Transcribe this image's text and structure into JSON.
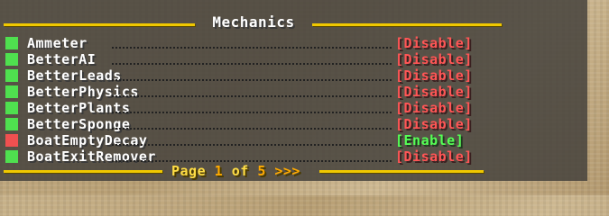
{
  "panel": {
    "title": "Mechanics"
  },
  "features": [
    {
      "name": "Ammeter",
      "enabled": true,
      "action": "[Disable]"
    },
    {
      "name": "BetterAI",
      "enabled": true,
      "action": "[Disable]"
    },
    {
      "name": "BetterLeads",
      "enabled": true,
      "action": "[Disable]"
    },
    {
      "name": "BetterPhysics",
      "enabled": true,
      "action": "[Disable]"
    },
    {
      "name": "BetterPlants",
      "enabled": true,
      "action": "[Disable]"
    },
    {
      "name": "BetterSponge",
      "enabled": true,
      "action": "[Disable]"
    },
    {
      "name": "BoatEmptyDecay",
      "enabled": false,
      "action": "[Enable]"
    },
    {
      "name": "BoatExitRemover",
      "enabled": true,
      "action": "[Disable]"
    }
  ],
  "pagination": {
    "label": "Page",
    "current": "1",
    "separator": "of",
    "total": "5",
    "next": ">>>"
  },
  "colors": {
    "enabled_indicator": "#4fe04f",
    "disabled_indicator": "#f05050",
    "disable_action": "#ff5555",
    "enable_action": "#55ff55",
    "rule_line": "#f0c800",
    "page_text": "#ffdd44",
    "page_number": "#ffaa00"
  }
}
